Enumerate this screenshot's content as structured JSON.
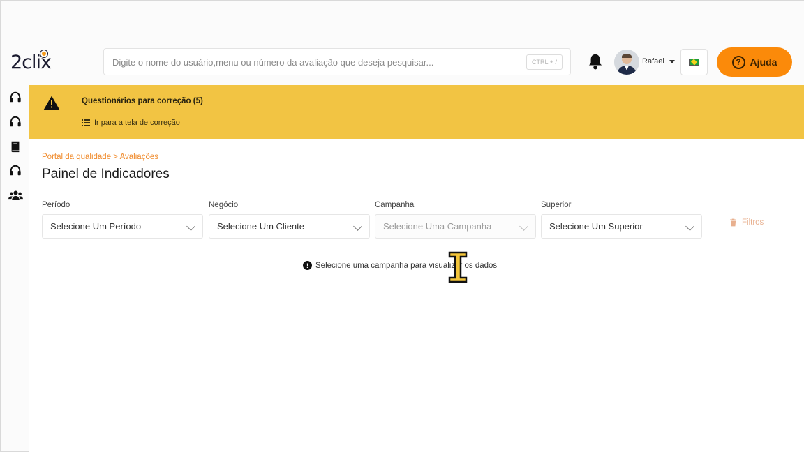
{
  "app": {
    "logo_text": "2clix"
  },
  "header": {
    "search_placeholder": "Digite o nome do usuário,menu ou número da avaliação que deseja pesquisar...",
    "search_shortcut": "CTRL + /",
    "user_name": "Rafael",
    "help_label": "Ajuda",
    "help_icon": "?"
  },
  "sidebar": {
    "items": [
      {
        "icon": "headset-icon"
      },
      {
        "icon": "headset-icon"
      },
      {
        "icon": "book-icon"
      },
      {
        "icon": "headset-icon"
      },
      {
        "icon": "users-icon"
      }
    ]
  },
  "alert": {
    "title": "Questionários para correção (5)",
    "link": "Ir para a tela de correção"
  },
  "main": {
    "breadcrumb": "Portal da qualidade > Avaliações",
    "title": "Painel de Indicadores",
    "filters": [
      {
        "label": "Período",
        "value": "Selecione Um Período",
        "disabled": false
      },
      {
        "label": "Negócio",
        "value": "Selecione Um Cliente",
        "disabled": false
      },
      {
        "label": "Campanha",
        "value": "Selecione Uma Campanha",
        "disabled": true
      },
      {
        "label": "Superior",
        "value": "Selecione Um Superior",
        "disabled": false
      }
    ],
    "filters_button": "Filtros",
    "notice": "Selecione uma campanha para visualizar os dados",
    "notice_icon": "!"
  },
  "colors": {
    "accent": "#fb8a0a",
    "alert_bg": "#f2c443",
    "breadcrumb": "#f08c2e"
  }
}
